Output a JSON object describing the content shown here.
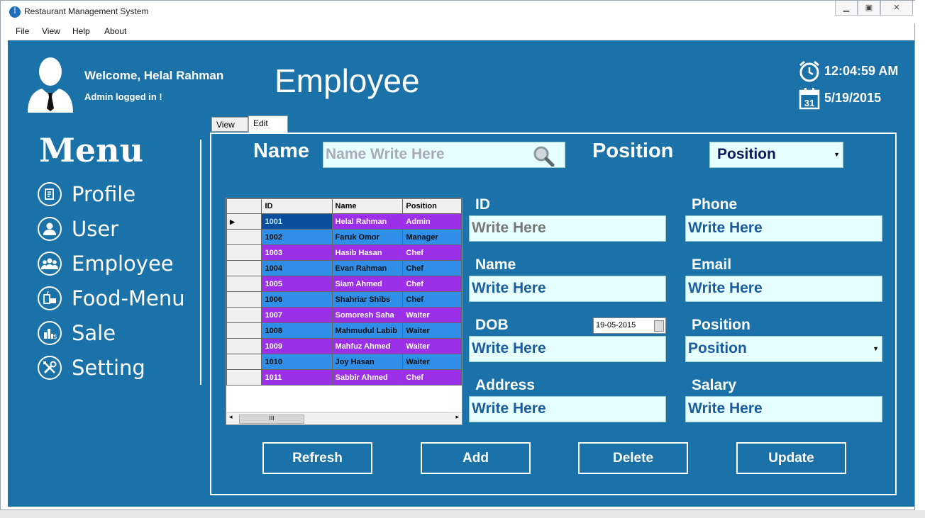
{
  "window": {
    "title": "Restaurant Management System"
  },
  "menubar": [
    "File",
    "View",
    "About"
  ],
  "menubar_help": "Help",
  "header": {
    "welcome": "Welcome, Helal Rahman",
    "status": "Admin logged in !",
    "page_title": "Employee",
    "time": "12:04:59 AM",
    "date": "5/19/2015",
    "calendar_day": "31"
  },
  "sidebar": {
    "heading": "Menu",
    "items": [
      {
        "label": "Profile",
        "icon": "profile-icon"
      },
      {
        "label": "User",
        "icon": "user-icon"
      },
      {
        "label": "Employee",
        "icon": "employee-icon"
      },
      {
        "label": "Food-Menu",
        "icon": "food-menu-icon"
      },
      {
        "label": "Sale",
        "icon": "sale-icon"
      },
      {
        "label": "Setting",
        "icon": "setting-icon"
      }
    ]
  },
  "tabs": {
    "view": "View",
    "edit": "Edit"
  },
  "search": {
    "name_label": "Name",
    "name_placeholder": "Name Write Here",
    "position_label": "Position",
    "position_value": "Position"
  },
  "grid": {
    "columns": [
      "ID",
      "Name",
      "Position"
    ],
    "rows": [
      [
        "1001",
        "Helal Rahman",
        "Admin"
      ],
      [
        "1002",
        "Faruk Omor",
        "Manager"
      ],
      [
        "1003",
        "Hasib Hasan",
        "Chef"
      ],
      [
        "1004",
        "Evan Rahman",
        "Chef"
      ],
      [
        "1005",
        "Siam Ahmed",
        "Chef"
      ],
      [
        "1006",
        "Shahriar Shibs",
        "Chef"
      ],
      [
        "1007",
        "Somoresh Saha",
        "Waiter"
      ],
      [
        "1008",
        "Mahmudul Labib",
        "Waiter"
      ],
      [
        "1009",
        "Mahfuz Ahmed",
        "Waiter"
      ],
      [
        "1010",
        "Joy Hasan",
        "Waiter"
      ],
      [
        "1011",
        "Sabbir Ahmed",
        "Chef"
      ]
    ],
    "scroll_thumb": "III"
  },
  "form": {
    "id_label": "ID",
    "id_value": "Write Here",
    "phone_label": "Phone",
    "phone_value": "Write Here",
    "name_label": "Name",
    "name_value": "Write Here",
    "email_label": "Email",
    "email_value": "Write Here",
    "dob_label": "DOB",
    "dob_value": "Write Here",
    "dob_picker": "19-05-2015",
    "position_label": "Position",
    "position_value": "Position",
    "address_label": "Address",
    "address_value": "Write Here",
    "salary_label": "Salary",
    "salary_value": "Write Here"
  },
  "buttons": {
    "refresh": "Refresh",
    "add": "Add",
    "delete": "Delete",
    "update": "Update"
  },
  "colors": {
    "background": "#1a72a8",
    "row_purple": "#9b30e8",
    "row_blue": "#2f8fe8",
    "field_bg": "#e6ffff"
  }
}
